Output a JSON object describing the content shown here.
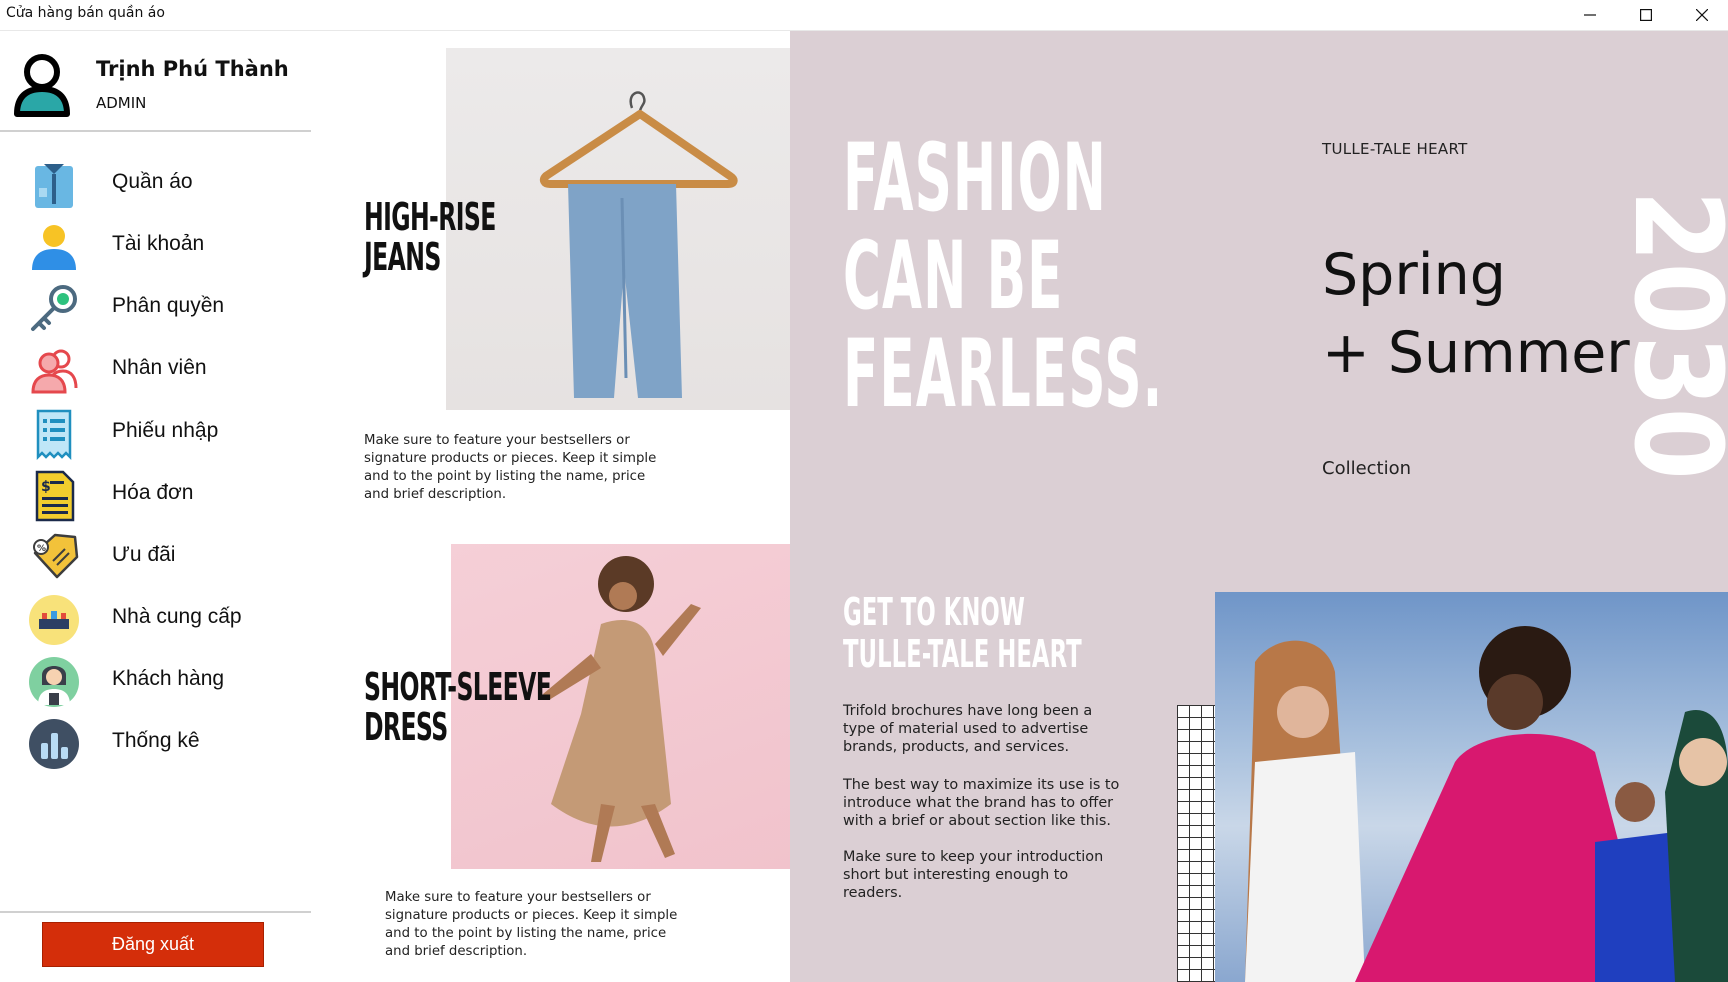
{
  "window": {
    "title": "Cửa hàng bán quần áo",
    "minimize_icon": "minimize-icon",
    "maximize_icon": "maximize-icon",
    "close_icon": "close-icon"
  },
  "sidebar": {
    "user": {
      "name": "Trịnh Phú Thành",
      "role": "ADMIN",
      "avatar_icon": "user-avatar-icon"
    },
    "items": [
      {
        "label": "Quần áo",
        "icon": "shirt-icon"
      },
      {
        "label": "Tài khoản",
        "icon": "account-icon"
      },
      {
        "label": "Phân quyền",
        "icon": "key-icon"
      },
      {
        "label": "Nhân viên",
        "icon": "employees-icon"
      },
      {
        "label": "Phiếu nhập",
        "icon": "receipt-icon"
      },
      {
        "label": "Hóa đơn",
        "icon": "invoice-icon"
      },
      {
        "label": "Ưu đãi",
        "icon": "discount-tag-icon"
      },
      {
        "label": "Nhà cung cấp",
        "icon": "supplier-icon"
      },
      {
        "label": "Khách hàng",
        "icon": "customer-icon"
      },
      {
        "label": "Thống kê",
        "icon": "statistics-icon"
      }
    ],
    "logout_label": "Đăng xuất",
    "logout_color": "#d42e0a"
  },
  "brochure": {
    "jeans": {
      "heading": "HIGH-RISE\nJEANS",
      "text": "Make sure to feature your bestsellers or signature products or pieces. Keep it simple and to the point by listing the name, price and brief description."
    },
    "dress": {
      "heading": "SHORT-SLEEVE\nDRESS",
      "text": "Make sure to feature your bestsellers or signature products or pieces. Keep it simple and to the point by listing the name, price and brief description."
    },
    "headline": "FASHION\nCAN BE\nFEARLESS.",
    "brand": "TULLE-TALE HEART",
    "season": "Spring\n+ Summer",
    "year": "2030",
    "collection": "Collection",
    "about_heading": "GET TO KNOW\nTULLE-TALE HEART",
    "about_paragraphs": [
      "Trifold brochures have long been a type of material used to advertise brands, products, and services.",
      "The best way to maximize its use is to introduce what the brand has to offer with a brief or about section like this.",
      "Make sure to keep your introduction short but interesting enough to readers."
    ],
    "right_background": "#dbcfd4"
  }
}
